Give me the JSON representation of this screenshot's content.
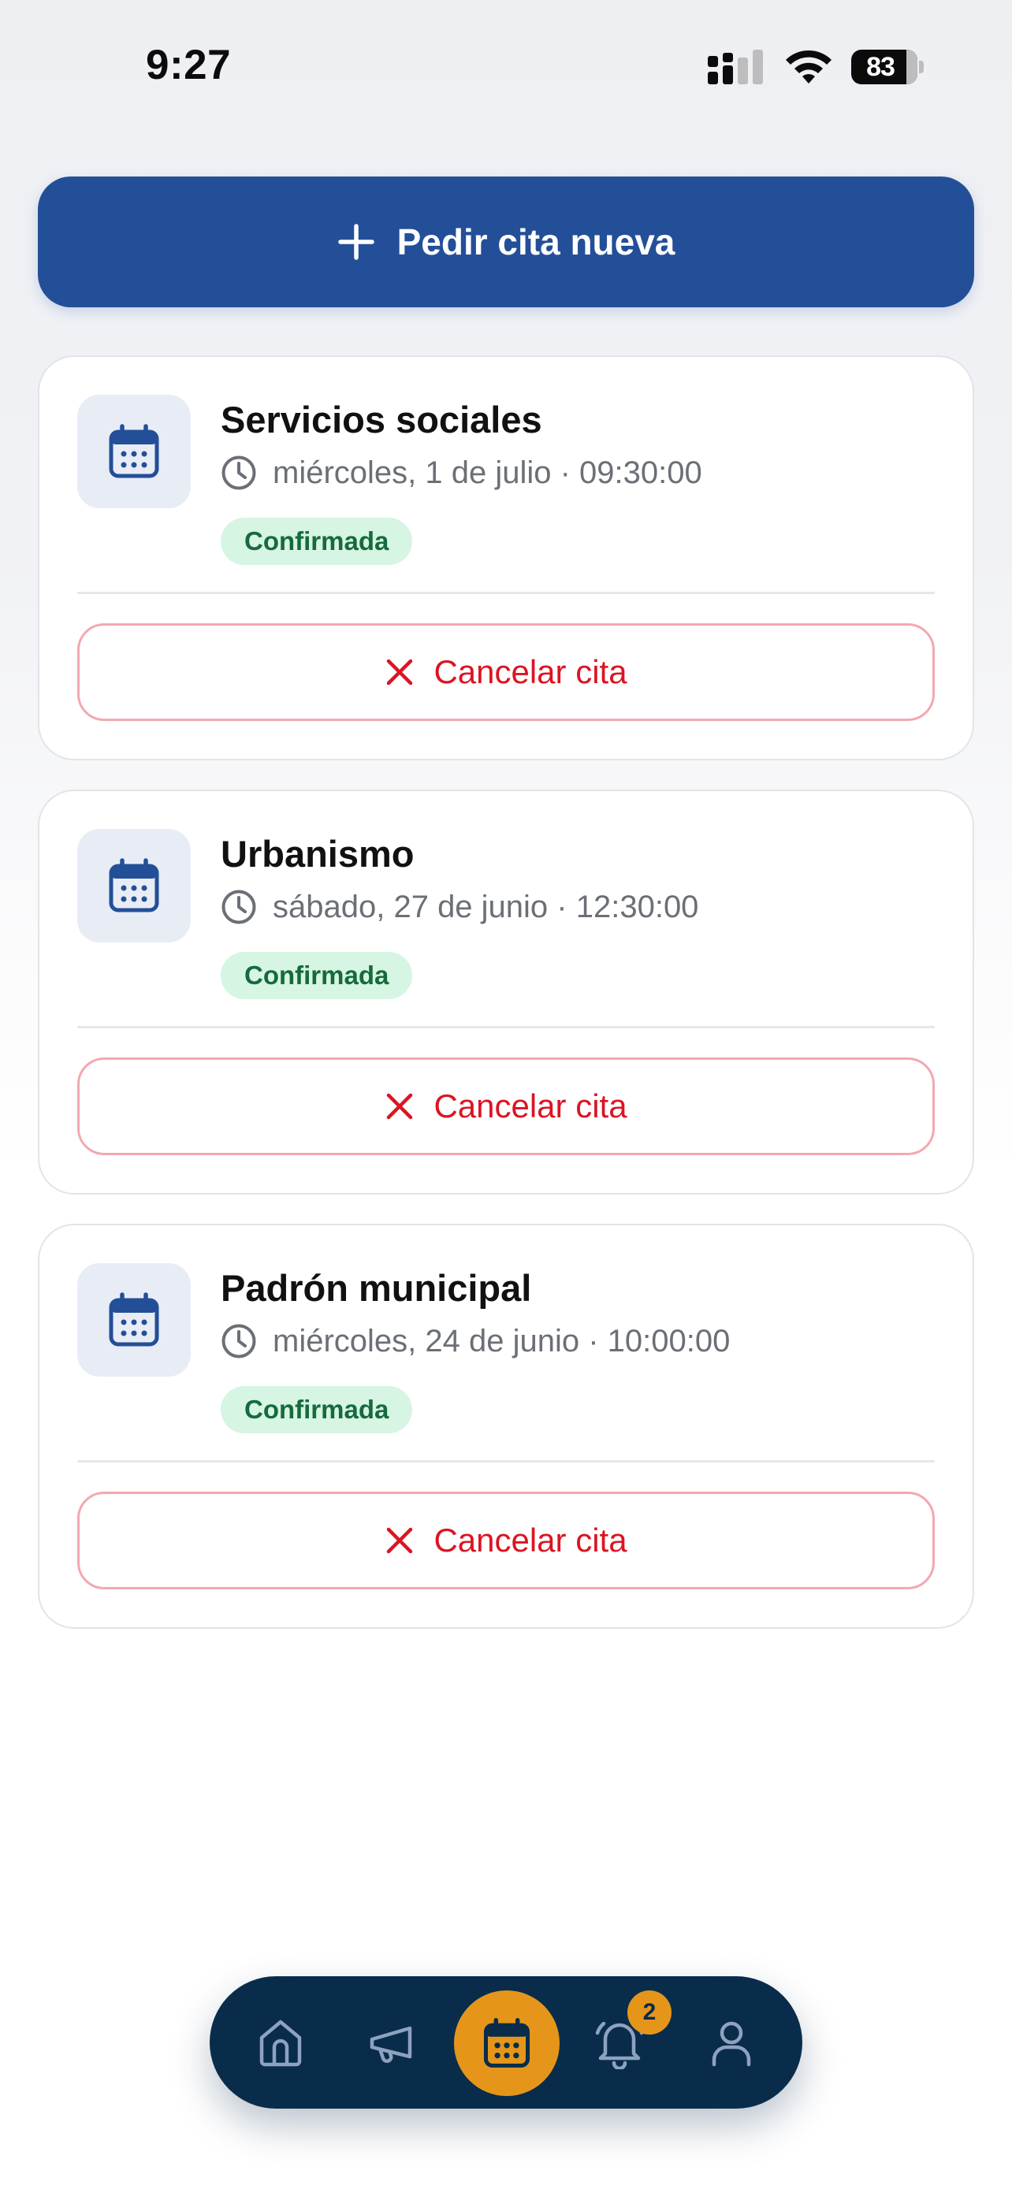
{
  "status_bar": {
    "time": "9:27",
    "battery": "83"
  },
  "new_appointment": {
    "label": "Pedir cita nueva"
  },
  "appointments": [
    {
      "title": "Servicios sociales",
      "datetime": "miércoles, 1 de julio · 09:30:00",
      "status": "Confirmada",
      "cancel_label": "Cancelar cita"
    },
    {
      "title": "Urbanismo",
      "datetime": "sábado, 27 de junio · 12:30:00",
      "status": "Confirmada",
      "cancel_label": "Cancelar cita"
    },
    {
      "title": "Padrón municipal",
      "datetime": "miércoles, 24 de junio · 10:00:00",
      "status": "Confirmada",
      "cancel_label": "Cancelar cita"
    }
  ],
  "bottom_nav": {
    "items": [
      {
        "icon": "home-icon"
      },
      {
        "icon": "megaphone-icon"
      },
      {
        "icon": "calendar-icon",
        "active": true
      },
      {
        "icon": "bell-icon"
      },
      {
        "icon": "user-icon"
      }
    ],
    "notifications_count": "2"
  },
  "colors": {
    "primary": "#234f98",
    "nav_bg": "#092c4b",
    "accent": "#e5961a",
    "danger": "#dc1422",
    "success_bg": "#d6f5e2",
    "success_text": "#166a3e"
  }
}
